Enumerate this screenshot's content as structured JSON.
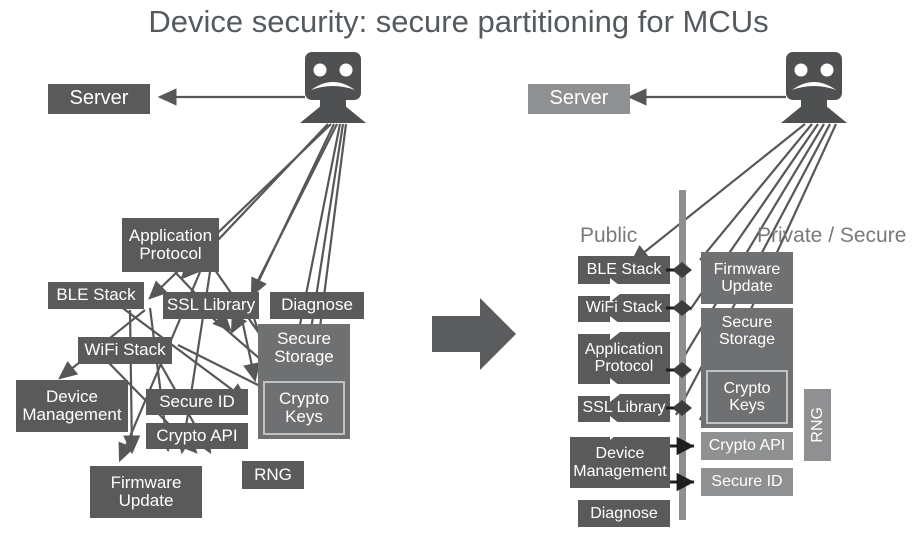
{
  "slide": {
    "title": "Device security: secure partitioning for MCUs",
    "background": "#ffffff"
  },
  "colors": {
    "box_dark": "#5a5a5a",
    "box_mid": "#6f7072",
    "box_light": "#8e9092",
    "text_on_box": "#ffffff",
    "title_text": "#555a5e",
    "section_text": "#77797b",
    "edge": "#555759",
    "divider": "#8d8f91",
    "connector": "#1f1f1f"
  },
  "left_diagram": {
    "name": "unpartitioned-mcu-diagram",
    "server": {
      "label": "Server",
      "shade": "dark"
    },
    "device_icon": "mcu-device-icon",
    "nodes": [
      {
        "id": "application-protocol",
        "lines": [
          "Application",
          "Protocol"
        ],
        "shade": "dark"
      },
      {
        "id": "ble-stack",
        "lines": [
          "BLE Stack"
        ],
        "shade": "dark"
      },
      {
        "id": "ssl-library",
        "lines": [
          "SSL Library"
        ],
        "shade": "dark"
      },
      {
        "id": "diagnose",
        "lines": [
          "Diagnose"
        ],
        "shade": "dark"
      },
      {
        "id": "wifi-stack",
        "lines": [
          "WiFi Stack"
        ],
        "shade": "dark"
      },
      {
        "id": "secure-storage",
        "lines": [
          "Secure",
          "Storage"
        ],
        "shade": "mid"
      },
      {
        "id": "device-management",
        "lines": [
          "Device",
          "Management"
        ],
        "shade": "dark"
      },
      {
        "id": "secure-id",
        "lines": [
          "Secure ID"
        ],
        "shade": "dark"
      },
      {
        "id": "crypto-keys",
        "lines": [
          "Crypto",
          "Keys"
        ],
        "shade": "inner"
      },
      {
        "id": "crypto-api",
        "lines": [
          "Crypto API"
        ],
        "shade": "dark"
      },
      {
        "id": "firmware-update",
        "lines": [
          "Firmware",
          "Update"
        ],
        "shade": "dark"
      },
      {
        "id": "rng",
        "lines": [
          "RNG"
        ],
        "shade": "dark"
      }
    ]
  },
  "transition_arrow": {
    "name": "transition-arrow",
    "direction": "right"
  },
  "right_diagram": {
    "name": "partitioned-mcu-diagram",
    "server": {
      "label": "Server",
      "shade": "light"
    },
    "device_icon": "mcu-device-icon",
    "sections": [
      {
        "id": "public",
        "label": "Public"
      },
      {
        "id": "private-secure",
        "label": "Private / Secure"
      }
    ],
    "public_nodes": [
      {
        "id": "ble-stack",
        "lines": [
          "BLE Stack"
        ],
        "shade": "dark"
      },
      {
        "id": "wifi-stack",
        "lines": [
          "WiFi Stack"
        ],
        "shade": "dark"
      },
      {
        "id": "application-protocol",
        "lines": [
          "Application",
          "Protocol"
        ],
        "shade": "dark"
      },
      {
        "id": "ssl-library",
        "lines": [
          "SSL Library"
        ],
        "shade": "dark"
      },
      {
        "id": "device-management",
        "lines": [
          "Device",
          "Management"
        ],
        "shade": "dark"
      },
      {
        "id": "diagnose",
        "lines": [
          "Diagnose"
        ],
        "shade": "dark"
      }
    ],
    "secure_nodes": [
      {
        "id": "firmware-update",
        "lines": [
          "Firmware",
          "Update"
        ],
        "shade": "mid"
      },
      {
        "id": "secure-storage",
        "lines": [
          "Secure",
          "Storage"
        ],
        "shade": "mid"
      },
      {
        "id": "crypto-keys",
        "lines": [
          "Crypto",
          "Keys"
        ],
        "shade": "inner"
      },
      {
        "id": "crypto-api",
        "lines": [
          "Crypto API"
        ],
        "shade": "light"
      },
      {
        "id": "secure-id",
        "lines": [
          "Secure ID"
        ],
        "shade": "light"
      },
      {
        "id": "rng",
        "lines": [
          "RNG"
        ],
        "shade": "light",
        "orientation": "vertical"
      }
    ]
  }
}
